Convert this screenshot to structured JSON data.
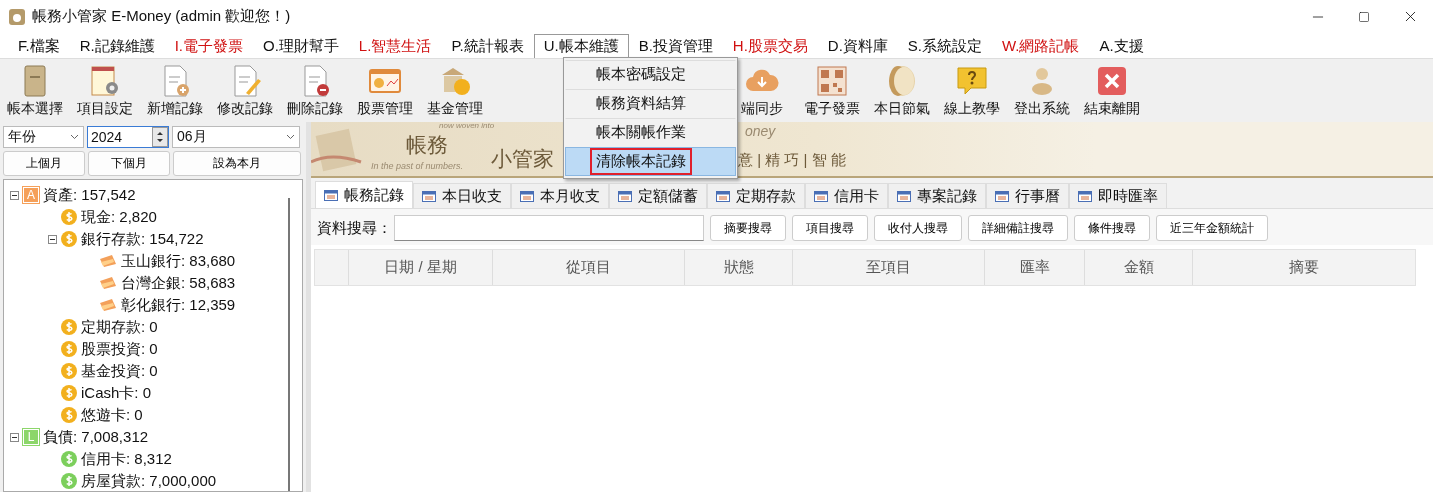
{
  "window": {
    "title": "帳務小管家 E-Money (admin 歡迎您！)"
  },
  "menu_bar": [
    {
      "label": "F.檔案",
      "selected": false
    },
    {
      "label": "R.記錄維護",
      "selected": false
    },
    {
      "label": "I.電子發票",
      "selected": false,
      "color": "#d01010"
    },
    {
      "label": "O.理財幫手",
      "selected": false
    },
    {
      "label": "L.智慧生活",
      "selected": false,
      "color": "#d01010"
    },
    {
      "label": "P.統計報表",
      "selected": false
    },
    {
      "label": "U.帳本維護",
      "selected": true
    },
    {
      "label": "B.投資管理",
      "selected": false
    },
    {
      "label": "H.股票交易",
      "selected": false,
      "color": "#d01010"
    },
    {
      "label": "D.資料庫",
      "selected": false
    },
    {
      "label": "S.系統設定",
      "selected": false
    },
    {
      "label": "W.網路記帳",
      "selected": false,
      "color": "#d01010"
    },
    {
      "label": "A.支援",
      "selected": false
    }
  ],
  "dropdown": [
    {
      "label": "帳本密碼設定",
      "selected": false
    },
    {
      "label": "帳務資料結算",
      "selected": false
    },
    {
      "label": "帳本關帳作業",
      "selected": false
    },
    {
      "label": "清除帳本記錄",
      "selected": true
    }
  ],
  "toolbar": {
    "left": [
      {
        "label": "帳本選擇",
        "kind": "book"
      },
      {
        "label": "項目設定",
        "kind": "notepad-gear"
      },
      {
        "label": "新增記錄",
        "kind": "doc-add"
      },
      {
        "label": "修改記錄",
        "kind": "doc-edit"
      },
      {
        "label": "刪除記錄",
        "kind": "doc-remove"
      },
      {
        "label": "股票管理",
        "kind": "chart-card"
      },
      {
        "label": "基金管理",
        "kind": "bank-coin"
      }
    ],
    "right": [
      {
        "label": "端同步",
        "kind": "cloud"
      },
      {
        "label": "電子發票",
        "kind": "qr"
      },
      {
        "label": "本日節氣",
        "kind": "season"
      },
      {
        "label": "線上教學",
        "kind": "help"
      },
      {
        "label": "登出系統",
        "kind": "person"
      },
      {
        "label": "結束離開",
        "kind": "close"
      }
    ]
  },
  "period": {
    "mode": "年份",
    "year": "2024",
    "month": "06月",
    "buttons": [
      "上個月",
      "下個月",
      "設為本月"
    ]
  },
  "tree": [
    {
      "badge": "A",
      "kind": "category",
      "label": "資產: 157,542",
      "expanded": true,
      "color": "#f5a05a",
      "children": [
        {
          "kind": "coin",
          "label": "現金: 2,820",
          "color": "#f2b01e"
        },
        {
          "kind": "coin",
          "label": "銀行存款: 154,722",
          "color": "#f2b01e",
          "expanded": true,
          "children": [
            {
              "kind": "card",
              "label": "玉山銀行: 83,680"
            },
            {
              "kind": "card",
              "label": "台灣企銀: 58,683"
            },
            {
              "kind": "card",
              "label": "彰化銀行: 12,359"
            }
          ]
        },
        {
          "kind": "coin",
          "label": "定期存款: 0",
          "color": "#f2b01e"
        },
        {
          "kind": "coin",
          "label": "股票投資: 0",
          "color": "#f2b01e"
        },
        {
          "kind": "coin",
          "label": "基金投資: 0",
          "color": "#f2b01e"
        },
        {
          "kind": "coin",
          "label": "iCash卡: 0",
          "color": "#f2b01e"
        },
        {
          "kind": "coin",
          "label": "悠遊卡: 0",
          "color": "#f2b01e"
        }
      ]
    },
    {
      "badge": "L",
      "kind": "category",
      "label": "負債: 7,008,312",
      "expanded": true,
      "color": "#8cd66a",
      "children": [
        {
          "kind": "coin",
          "label": "信用卡: 8,312",
          "color": "#7ccf5c"
        },
        {
          "kind": "coin",
          "label": "房屋貸款: 7,000,000",
          "color": "#7ccf5c"
        }
      ]
    }
  ],
  "banner": {
    "small_top": "now woven into",
    "small_bottom": "In the past of numbers.",
    "title_1": "帳務",
    "title_2": "小管家",
    "brand_tail": "oney",
    "slogan": "意 | 精 巧 | 智 能"
  },
  "tabs": [
    {
      "label": "帳務記錄",
      "selected": true
    },
    {
      "label": "本日收支",
      "selected": false
    },
    {
      "label": "本月收支",
      "selected": false
    },
    {
      "label": "定額儲蓄",
      "selected": false
    },
    {
      "label": "定期存款",
      "selected": false
    },
    {
      "label": "信用卡",
      "selected": false
    },
    {
      "label": "專案記錄",
      "selected": false
    },
    {
      "label": "行事曆",
      "selected": false
    },
    {
      "label": "即時匯率",
      "selected": false
    }
  ],
  "search": {
    "label": "資料搜尋：",
    "buttons": [
      "摘要搜尋",
      "項目搜尋",
      "收付人搜尋",
      "詳細備註搜尋",
      "條件搜尋",
      "近三年金額統計"
    ]
  },
  "table": {
    "columns": [
      "日期 / 星期",
      "從項目",
      "狀態",
      "至項目",
      "匯率",
      "金額",
      "摘要"
    ]
  }
}
